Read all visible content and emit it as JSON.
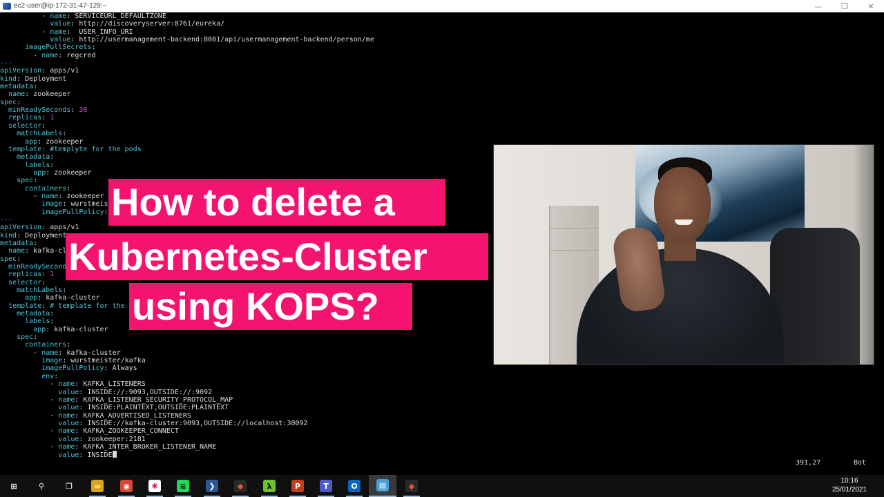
{
  "window": {
    "title": "ec2-user@ip-172-31-47-129:~",
    "minimize": "—",
    "maximize": "❐",
    "close": "✕"
  },
  "code_lines": [
    [
      {
        "t": "          - ",
        "c": "v"
      },
      {
        "t": "name",
        "c": "k"
      },
      {
        "t": ": SERVICEURL_DEFAULTZONE",
        "c": "v"
      }
    ],
    [
      {
        "t": "            ",
        "c": "v"
      },
      {
        "t": "value",
        "c": "k"
      },
      {
        "t": ": http://discoveryserver:8761/eureka/",
        "c": "v"
      }
    ],
    [
      {
        "t": "          - ",
        "c": "v"
      },
      {
        "t": "name",
        "c": "k"
      },
      {
        "t": ":  USER_INFO_URI",
        "c": "v"
      }
    ],
    [
      {
        "t": "            ",
        "c": "v"
      },
      {
        "t": "value",
        "c": "k"
      },
      {
        "t": ": http://usermanagement-backend:8081/api/usermanagement-backend/person/me",
        "c": "v"
      }
    ],
    [
      {
        "t": "      ",
        "c": "v"
      },
      {
        "t": "imagePullSecrets",
        "c": "k"
      },
      {
        "t": ":",
        "c": "v"
      }
    ],
    [
      {
        "t": "        - ",
        "c": "v"
      },
      {
        "t": "name",
        "c": "k"
      },
      {
        "t": ": regcred",
        "c": "v"
      }
    ],
    [
      {
        "t": "---",
        "c": "s"
      }
    ],
    [
      {
        "t": "apiVersion",
        "c": "k"
      },
      {
        "t": ": apps/v1",
        "c": "v"
      }
    ],
    [
      {
        "t": "kind",
        "c": "k"
      },
      {
        "t": ": Deployment",
        "c": "v"
      }
    ],
    [
      {
        "t": "metadata",
        "c": "k"
      },
      {
        "t": ":",
        "c": "v"
      }
    ],
    [
      {
        "t": "  ",
        "c": "v"
      },
      {
        "t": "name",
        "c": "k"
      },
      {
        "t": ": zookeeper",
        "c": "v"
      }
    ],
    [
      {
        "t": "spec",
        "c": "k"
      },
      {
        "t": ":",
        "c": "v"
      }
    ],
    [
      {
        "t": "  ",
        "c": "v"
      },
      {
        "t": "minReadySeconds",
        "c": "k"
      },
      {
        "t": ": ",
        "c": "v"
      },
      {
        "t": "30",
        "c": "n"
      }
    ],
    [
      {
        "t": "  ",
        "c": "v"
      },
      {
        "t": "replicas",
        "c": "k"
      },
      {
        "t": ": ",
        "c": "v"
      },
      {
        "t": "1",
        "c": "n"
      }
    ],
    [
      {
        "t": "  ",
        "c": "v"
      },
      {
        "t": "selector",
        "c": "k"
      },
      {
        "t": ":",
        "c": "v"
      }
    ],
    [
      {
        "t": "    ",
        "c": "v"
      },
      {
        "t": "matchLabels",
        "c": "k"
      },
      {
        "t": ":",
        "c": "v"
      }
    ],
    [
      {
        "t": "      ",
        "c": "v"
      },
      {
        "t": "app",
        "c": "k"
      },
      {
        "t": ": zookeeper",
        "c": "v"
      }
    ],
    [
      {
        "t": "  ",
        "c": "v"
      },
      {
        "t": "template",
        "c": "k"
      },
      {
        "t": ": #templyte for the pods",
        "c": "k"
      }
    ],
    [
      {
        "t": "    ",
        "c": "v"
      },
      {
        "t": "metadata",
        "c": "k"
      },
      {
        "t": ":",
        "c": "v"
      }
    ],
    [
      {
        "t": "      ",
        "c": "v"
      },
      {
        "t": "labels",
        "c": "k"
      },
      {
        "t": ":",
        "c": "v"
      }
    ],
    [
      {
        "t": "        ",
        "c": "v"
      },
      {
        "t": "app",
        "c": "k"
      },
      {
        "t": ": zookeeper",
        "c": "v"
      }
    ],
    [
      {
        "t": "    ",
        "c": "v"
      },
      {
        "t": "spec",
        "c": "k"
      },
      {
        "t": ":",
        "c": "v"
      }
    ],
    [
      {
        "t": "      ",
        "c": "v"
      },
      {
        "t": "containers",
        "c": "k"
      },
      {
        "t": ":",
        "c": "v"
      }
    ],
    [
      {
        "t": "        - ",
        "c": "v"
      },
      {
        "t": "name",
        "c": "k"
      },
      {
        "t": ": zookeeper",
        "c": "v"
      }
    ],
    [
      {
        "t": "          ",
        "c": "v"
      },
      {
        "t": "image",
        "c": "k"
      },
      {
        "t": ": wurstmeis",
        "c": "v"
      }
    ],
    [
      {
        "t": "          ",
        "c": "v"
      },
      {
        "t": "imagePullPolicy",
        "c": "k"
      },
      {
        "t": ":",
        "c": "v"
      }
    ],
    [
      {
        "t": "---",
        "c": "s"
      }
    ],
    [
      {
        "t": "apiVersion",
        "c": "k"
      },
      {
        "t": ": apps/v1",
        "c": "v"
      }
    ],
    [
      {
        "t": "kind",
        "c": "k"
      },
      {
        "t": ": Deployment",
        "c": "v"
      }
    ],
    [
      {
        "t": "metadata",
        "c": "k"
      },
      {
        "t": ":",
        "c": "v"
      }
    ],
    [
      {
        "t": "  ",
        "c": "v"
      },
      {
        "t": "name",
        "c": "k"
      },
      {
        "t": ": kafka-cl",
        "c": "v"
      }
    ],
    [
      {
        "t": "spec",
        "c": "k"
      },
      {
        "t": ":",
        "c": "v"
      }
    ],
    [
      {
        "t": "  ",
        "c": "v"
      },
      {
        "t": "minReadySecond",
        "c": "k"
      }
    ],
    [
      {
        "t": "  ",
        "c": "v"
      },
      {
        "t": "replicas",
        "c": "k"
      },
      {
        "t": ": ",
        "c": "v"
      },
      {
        "t": "1",
        "c": "n"
      }
    ],
    [
      {
        "t": "  ",
        "c": "v"
      },
      {
        "t": "selector",
        "c": "k"
      },
      {
        "t": ":",
        "c": "v"
      }
    ],
    [
      {
        "t": "    ",
        "c": "v"
      },
      {
        "t": "matchLabels",
        "c": "k"
      },
      {
        "t": ":",
        "c": "v"
      }
    ],
    [
      {
        "t": "      ",
        "c": "v"
      },
      {
        "t": "app",
        "c": "k"
      },
      {
        "t": ": kafka-cluster",
        "c": "v"
      }
    ],
    [
      {
        "t": "  ",
        "c": "v"
      },
      {
        "t": "template",
        "c": "k"
      },
      {
        "t": ": # template for the",
        "c": "k"
      }
    ],
    [
      {
        "t": "    ",
        "c": "v"
      },
      {
        "t": "metadata",
        "c": "k"
      },
      {
        "t": ":",
        "c": "v"
      }
    ],
    [
      {
        "t": "      ",
        "c": "v"
      },
      {
        "t": "labels",
        "c": "k"
      },
      {
        "t": ":",
        "c": "v"
      }
    ],
    [
      {
        "t": "        ",
        "c": "v"
      },
      {
        "t": "app",
        "c": "k"
      },
      {
        "t": ": kafka-cluster",
        "c": "v"
      }
    ],
    [
      {
        "t": "    ",
        "c": "v"
      },
      {
        "t": "spec",
        "c": "k"
      },
      {
        "t": ":",
        "c": "v"
      }
    ],
    [
      {
        "t": "      ",
        "c": "v"
      },
      {
        "t": "containers",
        "c": "k"
      },
      {
        "t": ":",
        "c": "v"
      }
    ],
    [
      {
        "t": "        - ",
        "c": "v"
      },
      {
        "t": "name",
        "c": "k"
      },
      {
        "t": ": kafka-cluster",
        "c": "v"
      }
    ],
    [
      {
        "t": "          ",
        "c": "v"
      },
      {
        "t": "image",
        "c": "k"
      },
      {
        "t": ": wurstmeister/kafka",
        "c": "v"
      }
    ],
    [
      {
        "t": "          ",
        "c": "v"
      },
      {
        "t": "imagePullPolicy",
        "c": "k"
      },
      {
        "t": ": Always",
        "c": "v"
      }
    ],
    [
      {
        "t": "          ",
        "c": "v"
      },
      {
        "t": "env",
        "c": "k"
      },
      {
        "t": ":",
        "c": "v"
      }
    ],
    [
      {
        "t": "            - ",
        "c": "v"
      },
      {
        "t": "name",
        "c": "k"
      },
      {
        "t": ": KAFKA_LISTENERS",
        "c": "v"
      }
    ],
    [
      {
        "t": "              ",
        "c": "v"
      },
      {
        "t": "value",
        "c": "k"
      },
      {
        "t": ": INSIDE://:9093,OUTSIDE://:9092",
        "c": "v"
      }
    ],
    [
      {
        "t": "            - ",
        "c": "v"
      },
      {
        "t": "name",
        "c": "k"
      },
      {
        "t": ": KAFKA_LISTENER_SECURITY_PROTOCOL_MAP",
        "c": "v"
      }
    ],
    [
      {
        "t": "              ",
        "c": "v"
      },
      {
        "t": "value",
        "c": "k"
      },
      {
        "t": ": INSIDE:PLAINTEXT,OUTSIDE:PLAINTEXT",
        "c": "v"
      }
    ],
    [
      {
        "t": "            - ",
        "c": "v"
      },
      {
        "t": "name",
        "c": "k"
      },
      {
        "t": ": KAFKA_ADVERTISED_LISTENERS",
        "c": "v"
      }
    ],
    [
      {
        "t": "              ",
        "c": "v"
      },
      {
        "t": "value",
        "c": "k"
      },
      {
        "t": ": INSIDE://kafka-cluster:9093,OUTSIDE://localhost:30092",
        "c": "v"
      }
    ],
    [
      {
        "t": "            - ",
        "c": "v"
      },
      {
        "t": "name",
        "c": "k"
      },
      {
        "t": ": KAFKA_ZOOKEEPER_CONNECT",
        "c": "v"
      }
    ],
    [
      {
        "t": "              ",
        "c": "v"
      },
      {
        "t": "value",
        "c": "k"
      },
      {
        "t": ": zookeeper:2181",
        "c": "v"
      }
    ],
    [
      {
        "t": "            - ",
        "c": "v"
      },
      {
        "t": "name",
        "c": "k"
      },
      {
        "t": ": KAFKA_INTER_BROKER_LISTENER_NAME",
        "c": "v"
      }
    ],
    [
      {
        "t": "              ",
        "c": "v"
      },
      {
        "t": "value",
        "c": "k"
      },
      {
        "t": ": INSIDE",
        "c": "v"
      }
    ]
  ],
  "status": {
    "position": "391,27",
    "where": "Bot"
  },
  "headline": {
    "line1": "How to delete a",
    "line2": "Kubernetes-Cluster",
    "line3": "using KOPS?",
    "bg_color": "#f4146f"
  },
  "taskbar": {
    "items": [
      {
        "name": "windows-start-icon",
        "glyph": "⊞",
        "color": "#ffffff",
        "bg": "transparent"
      },
      {
        "name": "search-icon",
        "glyph": "⚲",
        "color": "#ffffff",
        "bg": "transparent"
      },
      {
        "name": "task-view-icon",
        "glyph": "❐",
        "color": "#ffffff",
        "bg": "transparent"
      },
      {
        "name": "file-explorer-icon",
        "glyph": "▬",
        "color": "#ffd35a",
        "bg": "#d9a520"
      },
      {
        "name": "chrome-icon",
        "glyph": "◉",
        "color": "#ffffff",
        "bg": "#db4437"
      },
      {
        "name": "slack-icon",
        "glyph": "✱",
        "color": "#e01e5a",
        "bg": "#ffffff"
      },
      {
        "name": "spotify-icon",
        "glyph": "≋",
        "color": "#000000",
        "bg": "#1ed760"
      },
      {
        "name": "powershell-icon",
        "glyph": "❯",
        "color": "#ffffff",
        "bg": "#2b5797"
      },
      {
        "name": "git-gui-icon",
        "glyph": "◆",
        "color": "#f05033",
        "bg": "#2a2a2a"
      },
      {
        "name": "lambda-icon",
        "glyph": "λ",
        "color": "#000000",
        "bg": "#6fbf2f"
      },
      {
        "name": "powerpoint-icon",
        "glyph": "P",
        "color": "#ffffff",
        "bg": "#c43e1c"
      },
      {
        "name": "teams-icon",
        "glyph": "T",
        "color": "#ffffff",
        "bg": "#5059c9"
      },
      {
        "name": "outlook-icon",
        "glyph": "O",
        "color": "#ffffff",
        "bg": "#0a64c2"
      },
      {
        "name": "notes-app-icon",
        "glyph": "▤",
        "color": "#ffffff",
        "bg": "#4a9fd8"
      },
      {
        "name": "git-icon",
        "glyph": "◆",
        "color": "#f05033",
        "bg": "#2a2a2a"
      }
    ],
    "active_index": 13,
    "open_indices": [
      3,
      4,
      5,
      6,
      7,
      8,
      9,
      10,
      11,
      12,
      14
    ],
    "time": "10:16",
    "date": "25/01/2021"
  }
}
